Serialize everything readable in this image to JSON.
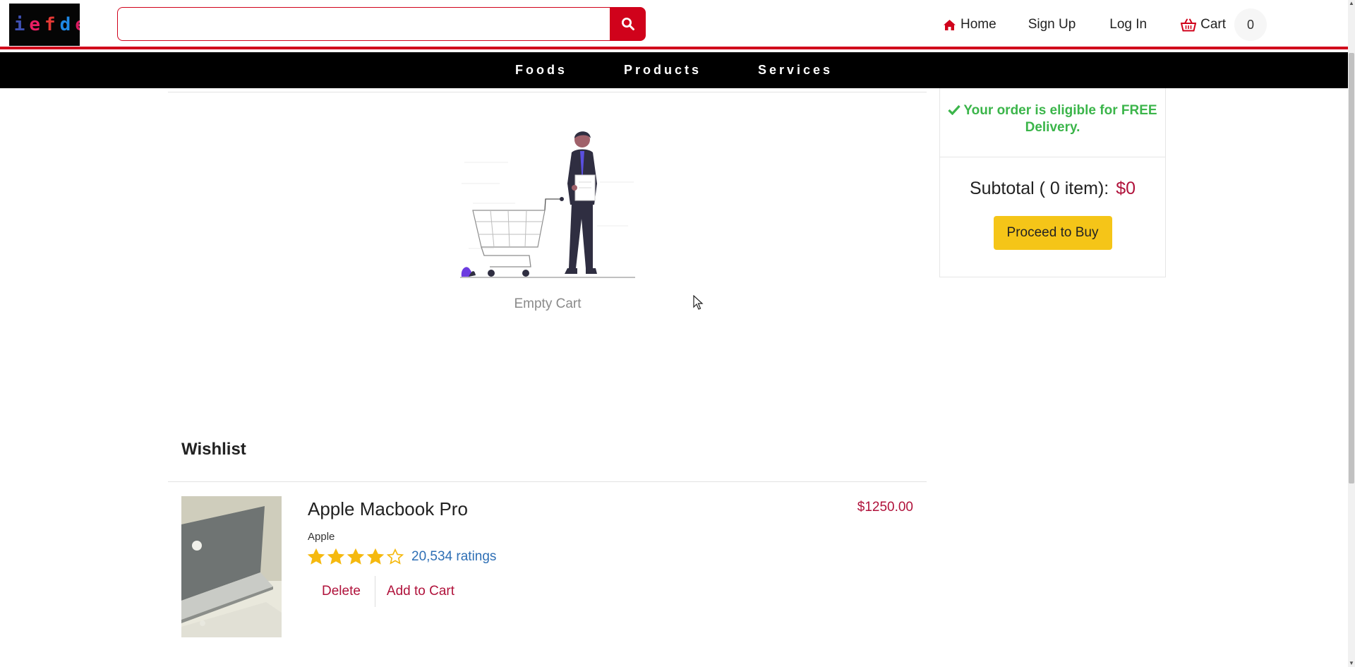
{
  "header": {
    "logo_text": "liefde",
    "search": {
      "value": "",
      "placeholder": ""
    },
    "search_icon": "search-icon",
    "nav": {
      "home_label": "Home",
      "home_icon": "home-icon",
      "signup_label": "Sign Up",
      "login_label": "Log In",
      "cart_label": "Cart",
      "cart_icon": "basket-icon",
      "cart_count": "0"
    }
  },
  "categories": [
    "Foods",
    "Products",
    "Services"
  ],
  "cart": {
    "empty_text": "Empty Cart"
  },
  "summary": {
    "delivery_text": "Your order is eligible for FREE Delivery.",
    "subtotal_label": "Subtotal ( 0 item):",
    "subtotal_amount": "$0",
    "proceed_label": "Proceed to Buy"
  },
  "wishlist": {
    "title": "Wishlist",
    "items": [
      {
        "name": "Apple Macbook Pro",
        "brand": "Apple",
        "price": "$1250.00",
        "rating": 4,
        "rating_max": 5,
        "ratings_text": "20,534 ratings",
        "delete_label": "Delete",
        "add_label": "Add to Cart"
      }
    ]
  },
  "colors": {
    "brand_red": "#d0021b",
    "price": "#b0123b",
    "delivery_green": "#3bb54a",
    "proceed_yellow": "#f5c518",
    "star": "#f5b90f",
    "link_blue": "#2e6fb5"
  }
}
